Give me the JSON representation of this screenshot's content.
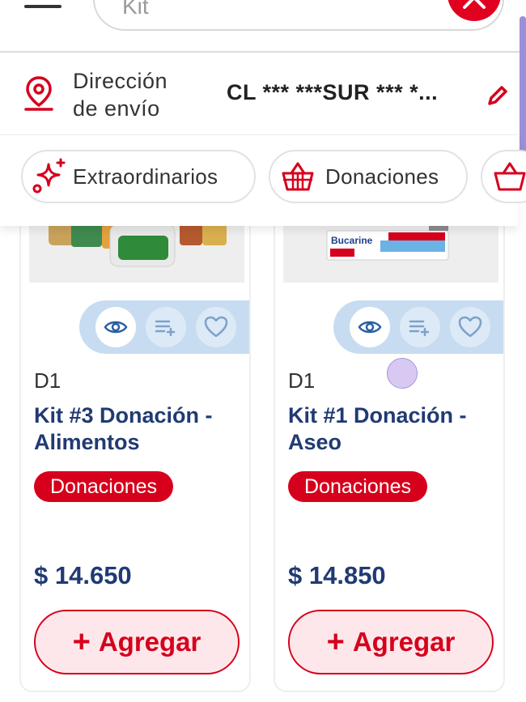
{
  "search": {
    "value": "Kit"
  },
  "address": {
    "label_line1": "Dirección",
    "label_line2": "de envío",
    "value": "CL *** ***SUR *** *..."
  },
  "chips": [
    {
      "label": "Extraordinarios",
      "icon": "sparkles-icon"
    },
    {
      "label": "Donaciones",
      "icon": "basket-icon"
    },
    {
      "label": "",
      "icon": "basket-icon"
    }
  ],
  "products": [
    {
      "brand": "D1",
      "name": "Kit #3 Donación - Alimentos",
      "tag": "Donaciones",
      "price": "$ 14.650",
      "add_label": "Agregar"
    },
    {
      "brand": "D1",
      "name": "Kit #1 Donación - Aseo",
      "tag": "Donaciones",
      "price": "$ 14.850",
      "add_label": "Agregar"
    }
  ],
  "colors": {
    "accent": "#d6001c",
    "navy": "#203a74",
    "action_bar": "#c7dcf0"
  }
}
